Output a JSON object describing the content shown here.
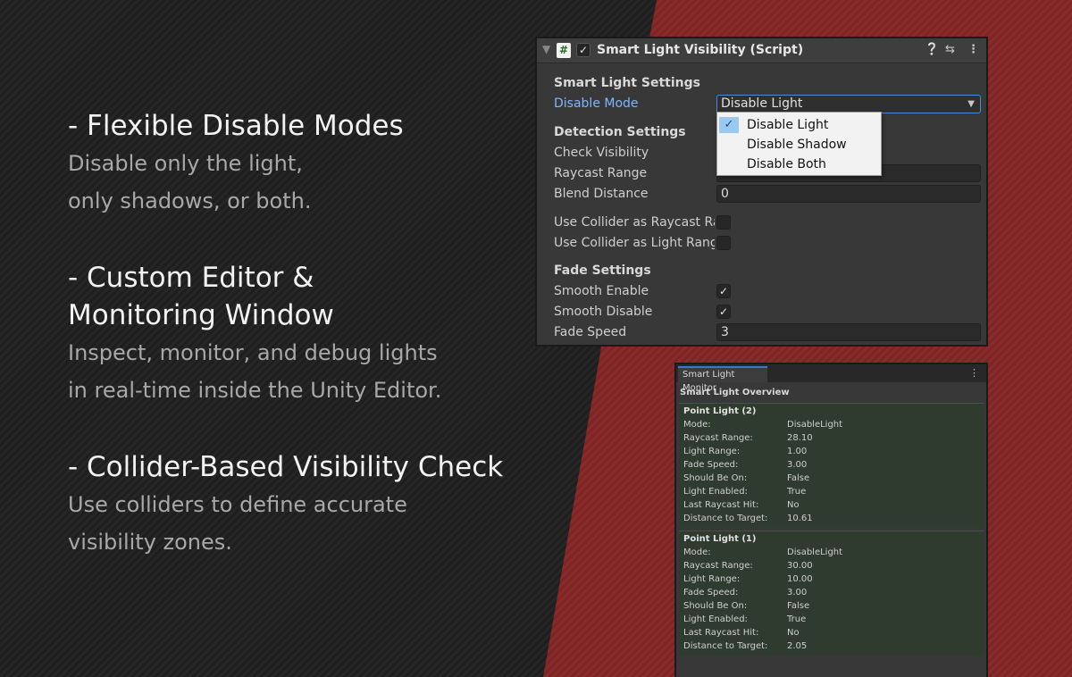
{
  "features": [
    {
      "title": "- Flexible Disable Modes",
      "desc": [
        "Disable only the light,",
        "only shadows, or both."
      ]
    },
    {
      "title": "- Custom Editor &",
      "title2": "Monitoring Window",
      "desc": [
        "Inspect, monitor, and debug lights",
        "in real-time inside the Unity Editor."
      ]
    },
    {
      "title": "- Collider-Based Visibility Check",
      "desc": [
        "Use colliders to define accurate",
        "visibility zones."
      ]
    }
  ],
  "inspector": {
    "title": "Smart Light Visibility (Script)",
    "icons": {
      "script": "#",
      "help": "help-icon",
      "presets": "presets-icon",
      "menu": "kebab-menu-icon"
    },
    "smart_light_settings": "Smart Light Settings",
    "disable_mode_label": "Disable Mode",
    "disable_mode_value": "Disable Light",
    "detection_settings": "Detection Settings",
    "check_visibility_label": "Check Visibility",
    "raycast_range_label": "Raycast Range",
    "blend_distance_label": "Blend Distance",
    "blend_distance_value": "0",
    "use_collider_raycast_label": "Use Collider as Raycast Range",
    "use_collider_light_label": "Use Collider as Light Range",
    "fade_settings": "Fade Settings",
    "smooth_enable_label": "Smooth Enable",
    "smooth_disable_label": "Smooth Disable",
    "fade_speed_label": "Fade Speed",
    "fade_speed_value": "3"
  },
  "dropdown_menu": {
    "items": [
      "Disable Light",
      "Disable Shadow",
      "Disable Both"
    ],
    "selected": "Disable Light"
  },
  "monitor": {
    "tab": "Smart Light Monitor",
    "overview": "Smart Light Overview",
    "lights": [
      {
        "name": "Point Light (2)",
        "rows": [
          {
            "k": "Mode:",
            "v": "DisableLight"
          },
          {
            "k": "Raycast Range:",
            "v": "28.10"
          },
          {
            "k": "Light Range:",
            "v": "1.00"
          },
          {
            "k": "Fade Speed:",
            "v": "3.00"
          },
          {
            "k": "Should Be On:",
            "v": "False"
          },
          {
            "k": "Light Enabled:",
            "v": "True"
          },
          {
            "k": "Last Raycast Hit:",
            "v": "No"
          },
          {
            "k": "Distance to Target:",
            "v": "10.61"
          }
        ]
      },
      {
        "name": "Point Light (1)",
        "rows": [
          {
            "k": "Mode:",
            "v": "DisableLight"
          },
          {
            "k": "Raycast Range:",
            "v": "30.00"
          },
          {
            "k": "Light Range:",
            "v": "10.00"
          },
          {
            "k": "Fade Speed:",
            "v": "3.00"
          },
          {
            "k": "Should Be On:",
            "v": "False"
          },
          {
            "k": "Light Enabled:",
            "v": "True"
          },
          {
            "k": "Last Raycast Hit:",
            "v": "No"
          },
          {
            "k": "Distance to Target:",
            "v": "2.05"
          }
        ]
      }
    ]
  },
  "colors": {
    "accent_blue": "#7eb7ff",
    "brand_red": "#8a2a2a",
    "monitor_green": "#2f3b2e"
  }
}
